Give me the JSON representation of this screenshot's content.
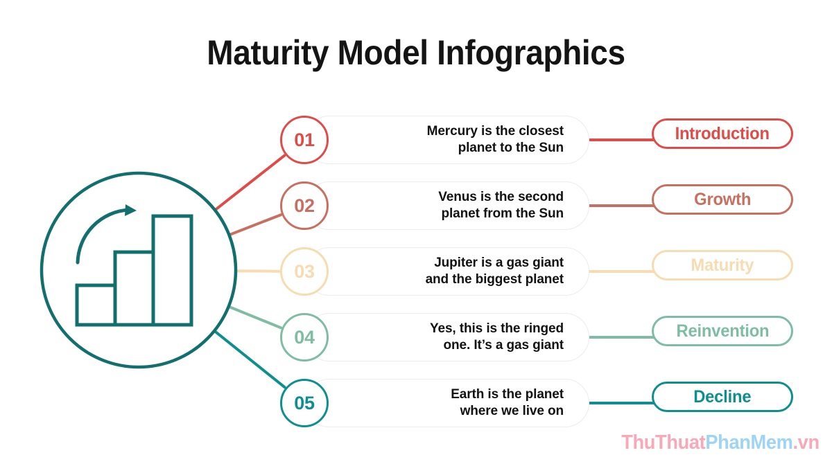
{
  "page": {
    "title": "Maturity Model Infographics",
    "background_color": "#ffffff"
  },
  "emblem": {
    "icon_name": "growth-bar-chart-icon",
    "color": "#11706e",
    "description": "circle outline containing three ascending bars and a curved rising arrow"
  },
  "rows": [
    {
      "number": "01",
      "text": "Mercury is the closest\nplanet to the Sun",
      "label": "Introduction",
      "color": "#e04b48"
    },
    {
      "number": "02",
      "text": "Venus is the second\nplanet from the Sun",
      "label": "Growth",
      "color": "#c77061"
    },
    {
      "number": "03",
      "text": "Jupiter is a gas giant\nand the biggest planet",
      "label": "Maturity",
      "color": "#f6dcb0"
    },
    {
      "number": "04",
      "text": "Yes, this is the ringed\none. It’s a gas giant",
      "label": "Reinvention",
      "color": "#7ebda3"
    },
    {
      "number": "05",
      "text": "Earth is the planet\nwhere we live on",
      "label": "Decline",
      "color": "#0d8f8d"
    }
  ],
  "content_pill": {
    "background_color": "#ffffff",
    "border_color": "#ececec"
  },
  "watermark": {
    "part1": "ThuThuat",
    "part2": "PhanMem",
    "part3": ".vn",
    "color1": "#f9a8b8",
    "color2": "#9ed4f5"
  }
}
